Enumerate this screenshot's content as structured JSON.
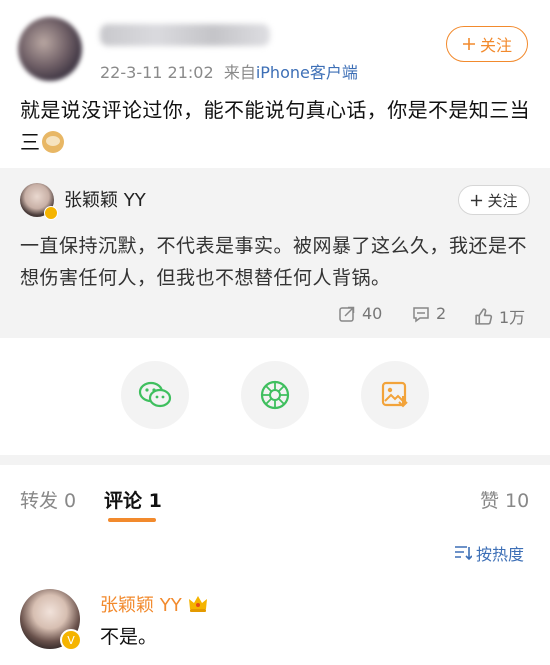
{
  "post": {
    "author_blurred": "••••••••••",
    "datetime": "22-3-11 21:02",
    "from_prefix": "来自",
    "source": "iPhone客户端",
    "follow_label": "关注",
    "text": "就是说没评论过你，能不能说句真心话，你是不是知三当三",
    "emoji": "doge-emoji"
  },
  "repost": {
    "author": "张颖颖 YY",
    "follow_label": "关注",
    "text": "一直保持沉默，不代表是事实。被网暴了这么久，我还是不想伤害任何人，但我也不想替任何人背锅。",
    "reposts": "40",
    "comments": "2",
    "likes": "1万"
  },
  "share": {
    "icons": [
      "wechat-icon",
      "moments-icon",
      "save-image-icon"
    ]
  },
  "tabs": {
    "repost": "转发 0",
    "comment": "评论 1",
    "like": "赞 10"
  },
  "sort_label": "按热度",
  "comment": {
    "author": "张颖颖 YY",
    "text": "不是。",
    "badge": "V"
  },
  "colors": {
    "accent": "#f28a2d",
    "link": "#3d6fb6",
    "wechat": "#3fbf5e",
    "card_bg": "#f3f3f3"
  }
}
